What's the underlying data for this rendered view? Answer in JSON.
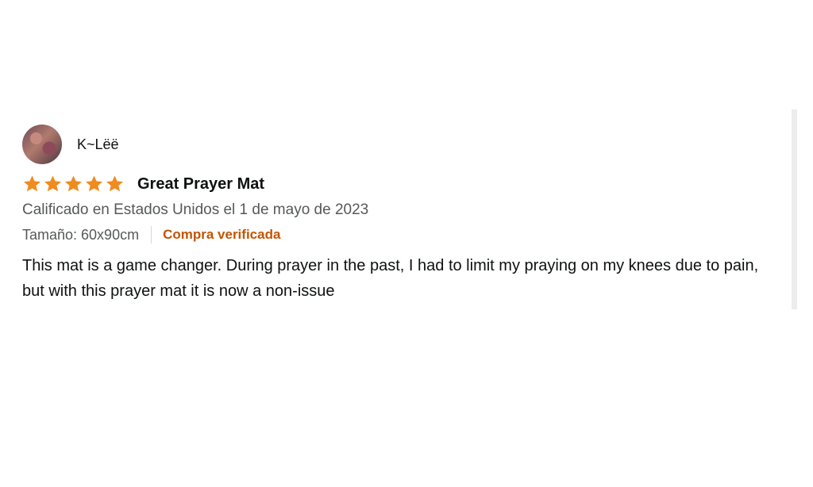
{
  "review": {
    "reviewer_name": "K~Lëë",
    "rating": 5,
    "rating_max": 5,
    "title": "Great Prayer Mat",
    "date_text": "Calificado en Estados Unidos el 1 de mayo de 2023",
    "size_text": "Tamaño: 60x90cm",
    "verified_text": "Compra verificada",
    "body": "This mat is a game changer. During prayer in the past, I had to limit my praying on my knees due to pain, but with this prayer mat it is now a non-issue"
  },
  "colors": {
    "star": "#f08b1e",
    "verified": "#c45500",
    "secondary_text": "#565959"
  },
  "icons": {
    "star": "star-icon"
  }
}
